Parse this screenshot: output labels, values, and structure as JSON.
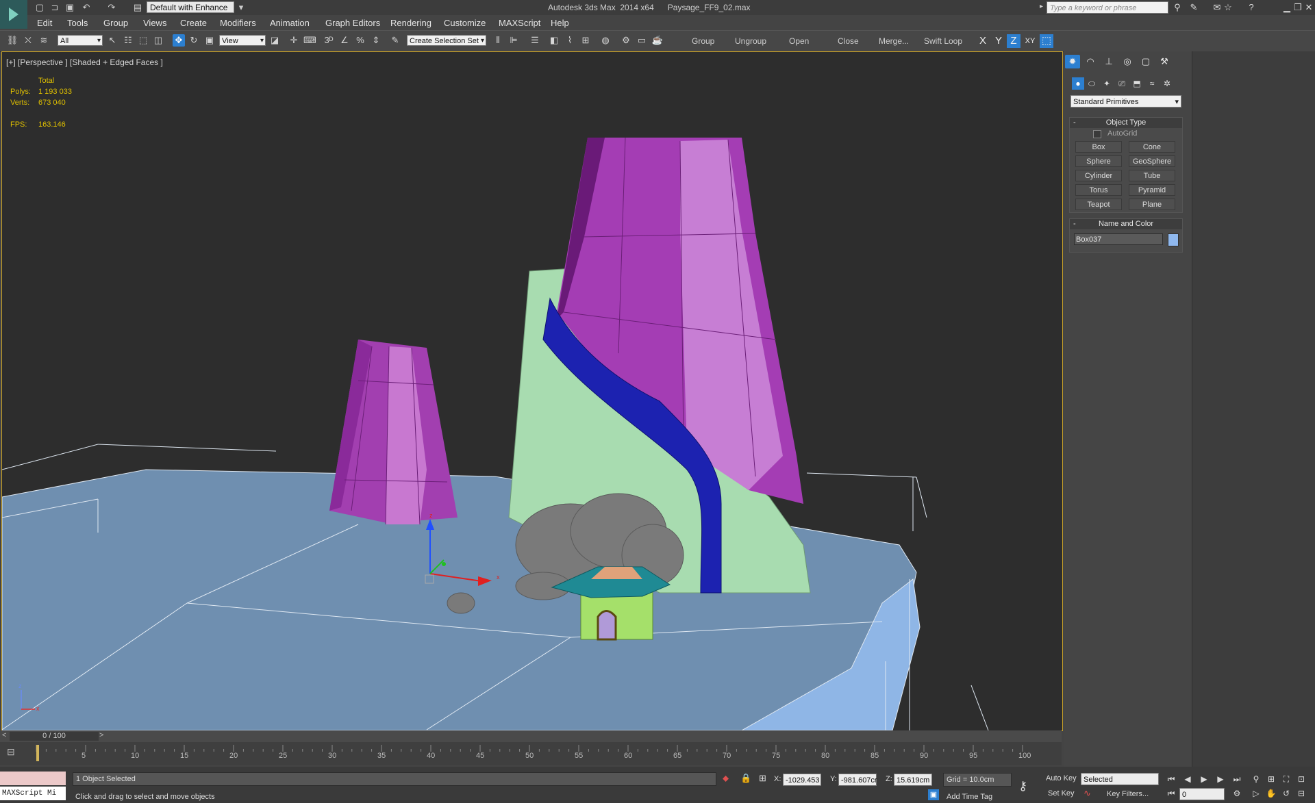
{
  "window": {
    "title": "Autodesk 3ds Max  2014 x64      Paysage_FF9_02.max",
    "workspace": "Default with Enhance",
    "search_placeholder": "Type a keyword or phrase"
  },
  "menu": [
    "Edit",
    "Tools",
    "Group",
    "Views",
    "Create",
    "Modifiers",
    "Animation",
    "Graph Editors",
    "Rendering",
    "Customize",
    "MAXScript",
    "Help"
  ],
  "toolbar": {
    "selection_filter": "All",
    "ref_coord": "View",
    "named_selection": "Create Selection Set",
    "group_buttons": [
      "Group",
      "Ungroup",
      "Open",
      "Close",
      "Merge...",
      "Swift Loop"
    ],
    "axes": [
      "X",
      "Y",
      "Z",
      "XY"
    ]
  },
  "viewport": {
    "label": "[+] [Perspective ] [Shaded + Edged Faces ]",
    "stats": {
      "header": "Total",
      "polys_label": "Polys:",
      "polys": "1 193 033",
      "verts_label": "Verts:",
      "verts": "673 040",
      "fps_label": "FPS:",
      "fps": "163.146"
    },
    "gizmo": {
      "x": "x",
      "y": "y",
      "z": "z"
    },
    "colors": {
      "background": "#2d2d2d",
      "ground": "#6f8fb0",
      "tower": "#b04ec0",
      "stair": "#1c22b0",
      "hill": "#a8dcb0",
      "rock": "#7a7a7a",
      "roof": "#1f8a94",
      "hut": "#a5e06a"
    }
  },
  "command_panel": {
    "dropdown": "Standard Primitives",
    "object_type": {
      "title": "Object Type",
      "autogrid": "AutoGrid",
      "buttons": [
        "Box",
        "Cone",
        "Sphere",
        "GeoSphere",
        "Cylinder",
        "Tube",
        "Torus",
        "Pyramid",
        "Teapot",
        "Plane"
      ]
    },
    "name_color": {
      "title": "Name and Color",
      "name": "Box037",
      "color": "#8fb8ee"
    }
  },
  "timeline": {
    "slider": "0 / 100",
    "ticks": [
      "5",
      "10",
      "15",
      "20",
      "25",
      "30",
      "35",
      "40",
      "45",
      "50",
      "55",
      "60",
      "65",
      "70",
      "75",
      "80",
      "85",
      "90",
      "95",
      "100"
    ]
  },
  "status": {
    "maxscript": "MAXScript Mi",
    "selected": "1 Object Selected",
    "prompt": "Click and drag to select and move objects",
    "x_label": "X:",
    "x": "-1029.453",
    "y_label": "Y:",
    "y": "-981.607cr",
    "z_label": "Z:",
    "z": "15.619cm",
    "grid": "Grid = 10.0cm",
    "add_time_tag": "Add Time Tag",
    "auto_key": "Auto Key",
    "set_key": "Set Key",
    "key_mode": "Selected",
    "key_filters": "Key Filters...",
    "frame": "0"
  }
}
